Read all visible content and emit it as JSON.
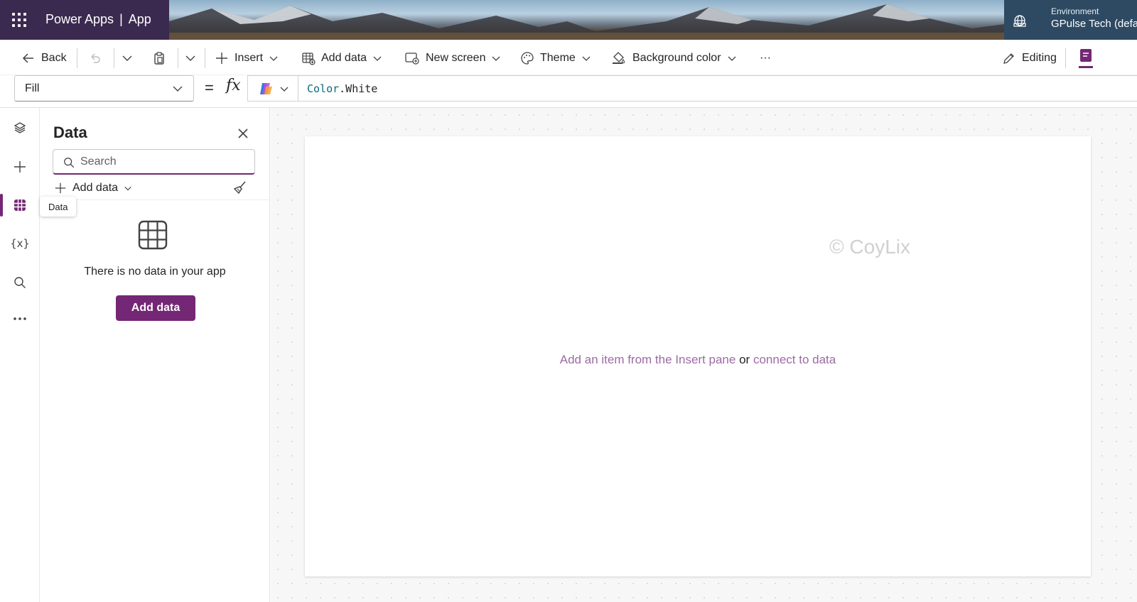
{
  "header": {
    "app_name": "Power Apps",
    "separator": "|",
    "app_label": "App",
    "environment_label": "Environment",
    "environment_name": "GPulse Tech (defa"
  },
  "toolbar": {
    "back": "Back",
    "insert": "Insert",
    "add_data": "Add data",
    "new_screen": "New screen",
    "theme": "Theme",
    "background_color": "Background color",
    "more": "···",
    "editing": "Editing"
  },
  "formula_bar": {
    "property": "Fill",
    "equals": "=",
    "fx": "fx",
    "formula_object": "Color",
    "formula_member": ".White"
  },
  "left_rail": {
    "variables_label": "{x}",
    "tooltip": "Data"
  },
  "data_pane": {
    "title": "Data",
    "search_placeholder": "Search",
    "add_data_label": "Add data",
    "empty_message": "There is no data in your app",
    "add_data_button": "Add data"
  },
  "canvas": {
    "watermark": "© CoyLix",
    "hint_link_insert": "Add an item from the Insert pane",
    "hint_or": "or",
    "hint_link_connect": "connect to data"
  },
  "colors": {
    "accent": "#742774",
    "link": "#9c6aa3",
    "header_bg": "#3b2a4f"
  }
}
